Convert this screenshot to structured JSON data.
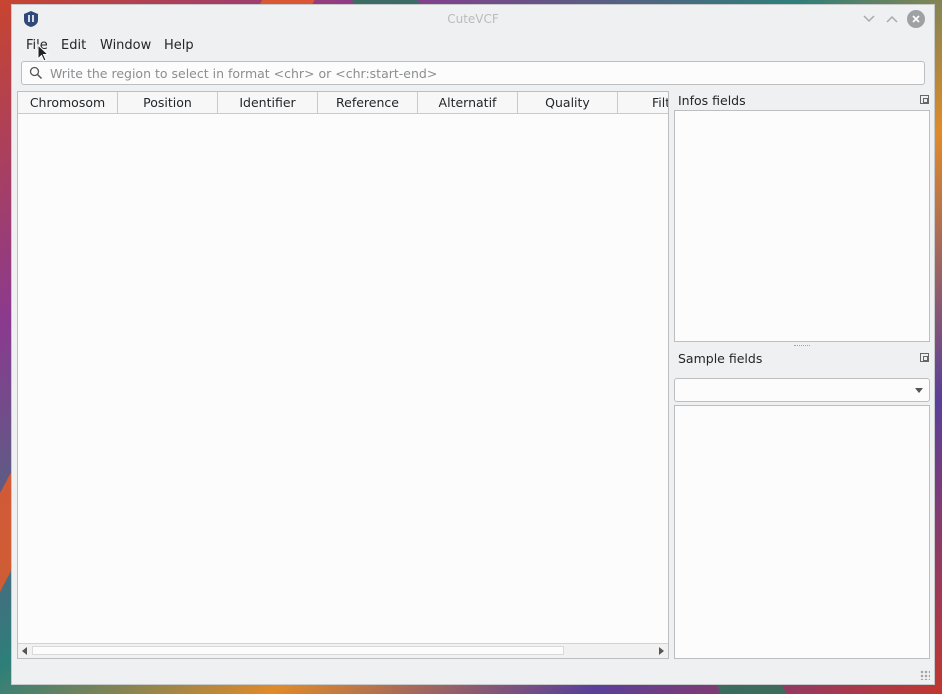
{
  "window": {
    "title": "CuteVCF"
  },
  "menu": {
    "items": [
      {
        "label": "File"
      },
      {
        "label": "Edit"
      },
      {
        "label": "Window"
      },
      {
        "label": "Help"
      }
    ]
  },
  "search": {
    "placeholder": "Write the region to select in format <chr> or <chr:start-end>",
    "value": ""
  },
  "table": {
    "columns": [
      "Chromosom",
      "Position",
      "Identifier",
      "Reference",
      "Alternatif",
      "Quality",
      "Filter"
    ],
    "rows": []
  },
  "docks": {
    "infos_title": "Infos fields",
    "sample_title": "Sample fields",
    "sample_combo_value": ""
  },
  "colors": {
    "accent": "#3daee9",
    "window_bg": "#eff0f1",
    "panel_bg": "#fcfcfc"
  },
  "icons": [
    "app-icon",
    "minimize-icon",
    "maximize-icon",
    "close-icon",
    "search-icon",
    "float-icon",
    "chevron-down-icon",
    "arrow-left-icon",
    "arrow-right-icon"
  ]
}
